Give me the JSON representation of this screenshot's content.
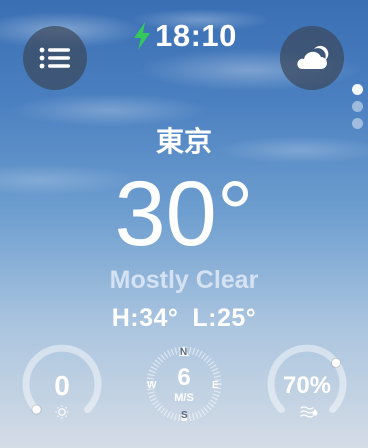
{
  "status": {
    "time": "18:10",
    "charging": true
  },
  "location": {
    "name": "東京"
  },
  "current": {
    "temperature": "30°",
    "condition": "Mostly Clear",
    "high": "H:34°",
    "low": "L:25°"
  },
  "pager": {
    "count": 3,
    "active_index": 0
  },
  "complications": {
    "uv": {
      "value": "0",
      "level_fraction": 0.0
    },
    "wind": {
      "speed": "6",
      "unit": "M/S",
      "directions": {
        "n": "N",
        "e": "E",
        "s": "S",
        "w": "W"
      }
    },
    "humidity": {
      "value": "70%",
      "level_fraction": 0.7
    }
  },
  "colors": {
    "charging_bolt": "#34c759",
    "button_bg": "#3c485c"
  },
  "icons": {
    "menu": "list-icon",
    "weather": "cloud-moon-icon",
    "charging": "bolt-icon",
    "uv": "sun-icon",
    "humidity": "humidity-icon"
  }
}
